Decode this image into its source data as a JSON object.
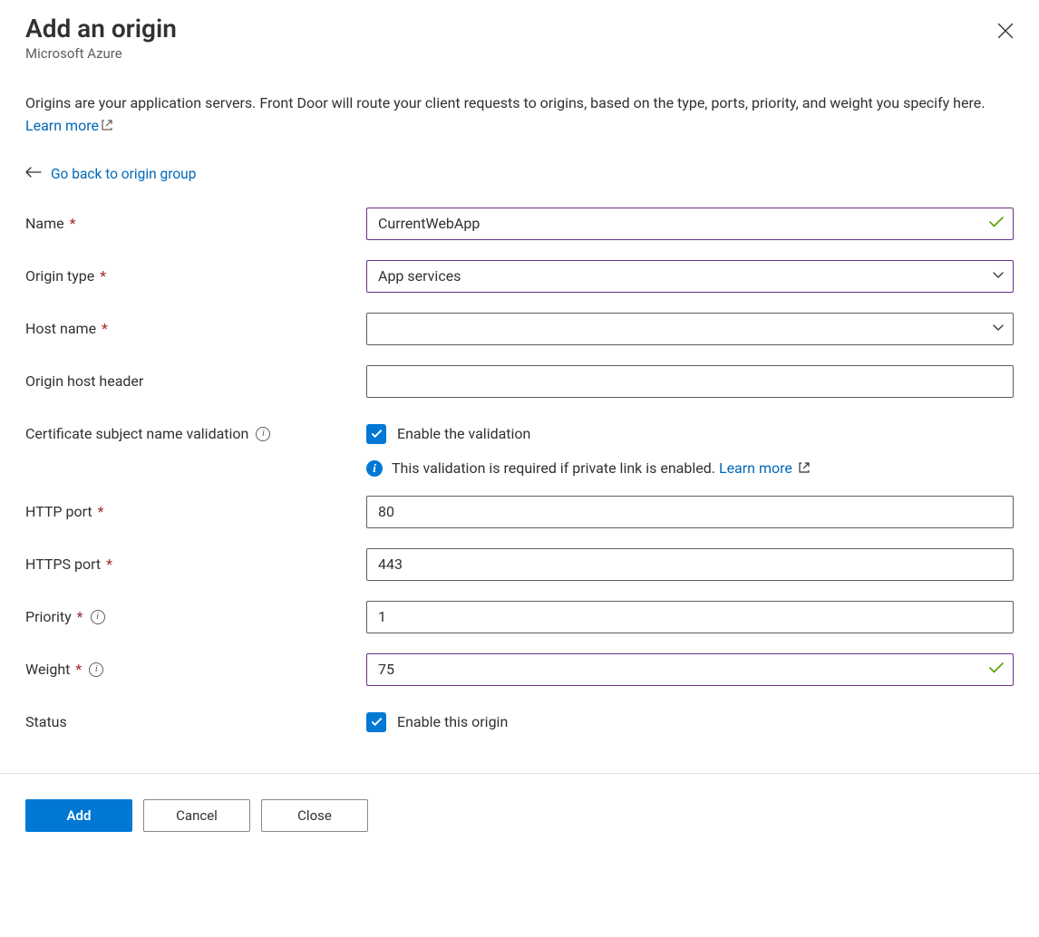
{
  "header": {
    "title": "Add an origin",
    "subtitle": "Microsoft Azure"
  },
  "description": {
    "text": "Origins are your application servers. Front Door will route your client requests to origins, based on the type, ports, priority, and weight you specify here. ",
    "learn_more": "Learn more"
  },
  "back_link": "Go back to origin group",
  "fields": {
    "name": {
      "label": "Name",
      "value": "CurrentWebApp"
    },
    "origin_type": {
      "label": "Origin type",
      "value": "App services"
    },
    "host_name": {
      "label": "Host name",
      "value": ""
    },
    "origin_host_header": {
      "label": "Origin host header",
      "value": ""
    },
    "cert_validation": {
      "label": "Certificate subject name validation",
      "checkbox_label": "Enable the validation"
    },
    "cert_info": {
      "text": "This validation is required if private link is enabled. ",
      "learn_more": "Learn more"
    },
    "http_port": {
      "label": "HTTP port",
      "value": "80"
    },
    "https_port": {
      "label": "HTTPS port",
      "value": "443"
    },
    "priority": {
      "label": "Priority",
      "value": "1"
    },
    "weight": {
      "label": "Weight",
      "value": "75"
    },
    "status": {
      "label": "Status",
      "checkbox_label": "Enable this origin"
    }
  },
  "footer": {
    "add": "Add",
    "cancel": "Cancel",
    "close": "Close"
  }
}
